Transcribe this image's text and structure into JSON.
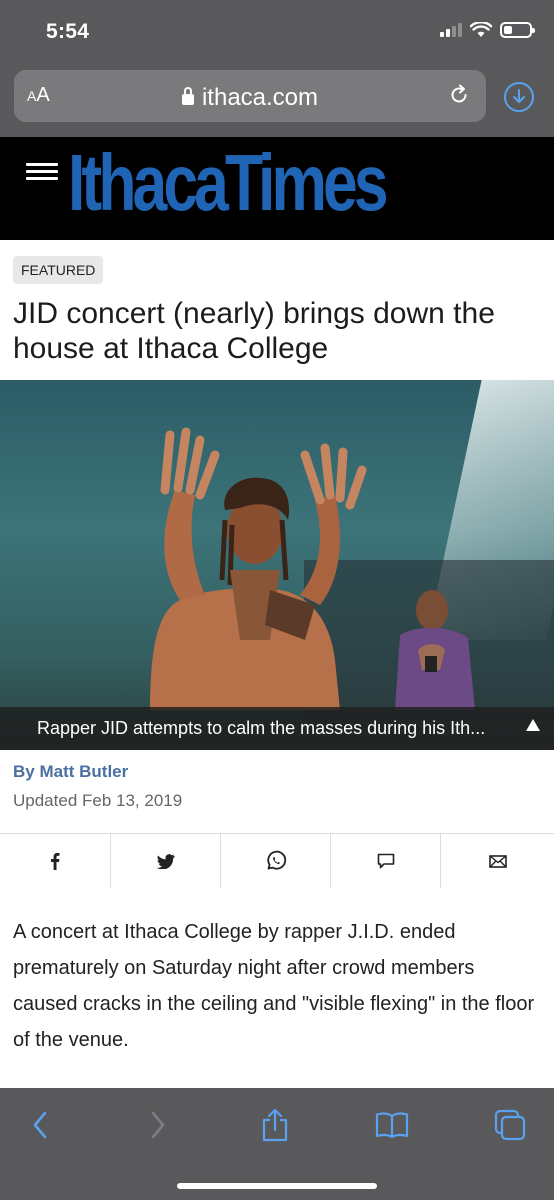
{
  "status_bar": {
    "time": "5:54"
  },
  "browser": {
    "text_size_label": "AA",
    "url": "ithaca.com"
  },
  "site": {
    "logo_text": "IthacaTimes"
  },
  "article": {
    "badge": "FEATURED",
    "headline": "JID concert (nearly) brings down the house at Ithaca College",
    "image_caption": "Rapper JID attempts to calm the masses during his Ith...",
    "byline": "By Matt Butler",
    "updated": "Updated Feb 13, 2019",
    "body": "A concert at Ithaca College by rapper J.I.D. ended prematurely on Saturday night after crowd members caused cracks in the ceiling and \"visible flexing\" in the floor of the venue."
  },
  "share_buttons": [
    "facebook-icon",
    "twitter-icon",
    "whatsapp-icon",
    "comment-icon",
    "email-icon"
  ],
  "toolbar_buttons": [
    "back-icon",
    "forward-icon",
    "share-icon",
    "bookmarks-icon",
    "tabs-icon"
  ],
  "colors": {
    "browser_chrome": "#59595b",
    "logo_blue": "#1f64b5",
    "byline_blue": "#4a6fa0",
    "ios_blue": "#5aa1f0"
  }
}
